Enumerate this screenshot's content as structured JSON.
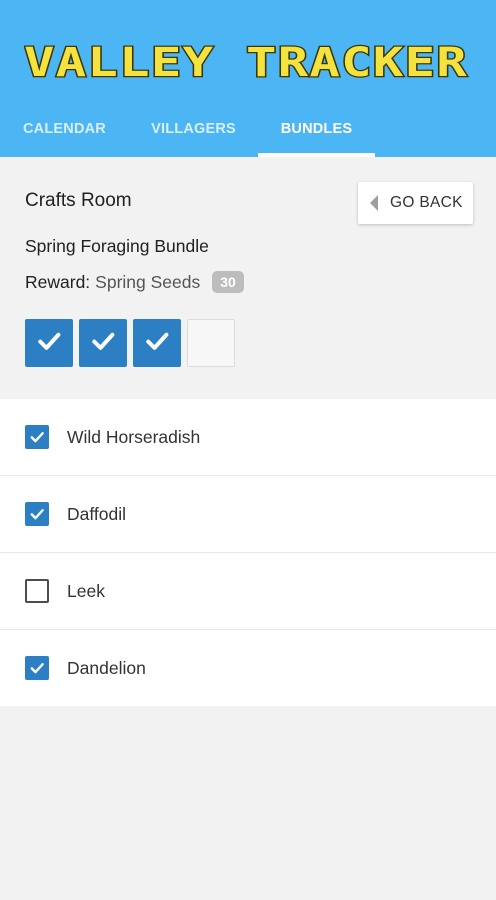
{
  "app": {
    "title": "VALLEY TRACKER"
  },
  "tabs": [
    {
      "label": "CALENDAR",
      "active": false
    },
    {
      "label": "VILLAGERS",
      "active": false
    },
    {
      "label": "BUNDLES",
      "active": true
    }
  ],
  "room": {
    "title": "Crafts Room",
    "back_label": "GO BACK"
  },
  "bundle": {
    "name": "Spring Foraging Bundle",
    "reward_label": "Reward:",
    "reward_value": "Spring Seeds",
    "reward_count": "30",
    "slots": [
      true,
      true,
      true,
      false
    ]
  },
  "items": [
    {
      "label": "Wild Horseradish",
      "checked": true
    },
    {
      "label": "Daffodil",
      "checked": true
    },
    {
      "label": "Leek",
      "checked": false
    },
    {
      "label": "Dandelion",
      "checked": true
    }
  ],
  "colors": {
    "appbar": "#4cb6f5",
    "accent": "#2d7fc4",
    "logo": "#f4e23e",
    "badge": "#bdbdbd"
  }
}
